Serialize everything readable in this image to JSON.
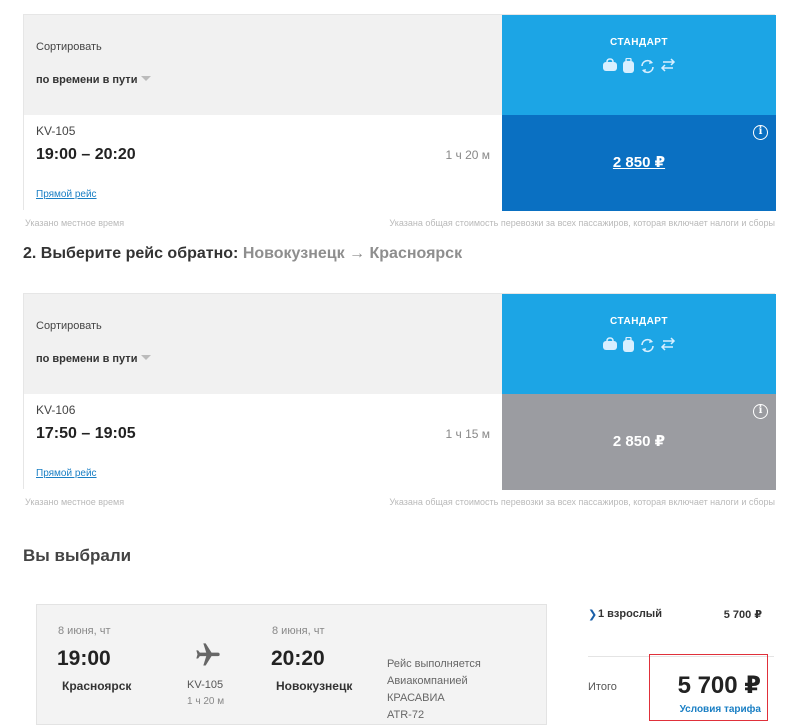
{
  "outbound": {
    "sort_label": "Сортировать",
    "sort_value": "по времени в пути",
    "fare_title": "СТАНДАРТ",
    "fare_icons": [
      "bag-icon",
      "luggage-icon",
      "exchange-icon",
      "return-icon"
    ],
    "flight": {
      "number": "KV-105",
      "time": "19:00 – 20:20",
      "duration": "1 ч 20 м",
      "type": "Прямой рейс",
      "price": "2 850 ₽",
      "state": "selected"
    },
    "note_left": "Указано местное время",
    "note_right": "Указана общая стоимость перевозки за всех пассажиров, которая включает налоги и сборы"
  },
  "return_step": {
    "title_prefix": "2. Выберите рейс обратно:",
    "from": "Новокузнецк",
    "arrow": "→",
    "to": "Красноярск"
  },
  "inbound": {
    "sort_label": "Сортировать",
    "sort_value": "по времени в пути",
    "fare_title": "СТАНДАРТ",
    "flight": {
      "number": "KV-106",
      "time": "17:50 – 19:05",
      "duration": "1 ч 15 м",
      "type": "Прямой рейс",
      "price": "2 850 ₽",
      "state": "unselected"
    },
    "note_left": "Указано местное время",
    "note_right": "Указана общая стоимость перевозки за всех пассажиров, которая включает налоги и сборы"
  },
  "selection": {
    "title": "Вы выбрали",
    "dep_date": "8 июня, чт",
    "dep_time": "19:00",
    "dep_city": "Красноярск",
    "flight_no": "KV-105",
    "flight_dur": "1 ч 20 м",
    "arr_date": "8 июня, чт",
    "arr_time": "20:20",
    "arr_city": "Новокузнецк",
    "operator_line1": "Рейс выполняется",
    "operator_line2": "Авиакомпанией",
    "operator_line3": "КРАСАВИА",
    "operator_line4": "ATR-72"
  },
  "totals": {
    "pax_label": "1 взрослый",
    "pax_price": "5 700 ₽",
    "total_label": "Итого",
    "total_value": "5 700 ₽",
    "fare_terms": "Условия тарифа"
  },
  "colors": {
    "fare_header": "#1ca5e5",
    "selected_price": "#0a70c2",
    "unselected_price": "#9b9ca1",
    "link": "#1a7fc4",
    "highlight_border": "#e0303a"
  }
}
